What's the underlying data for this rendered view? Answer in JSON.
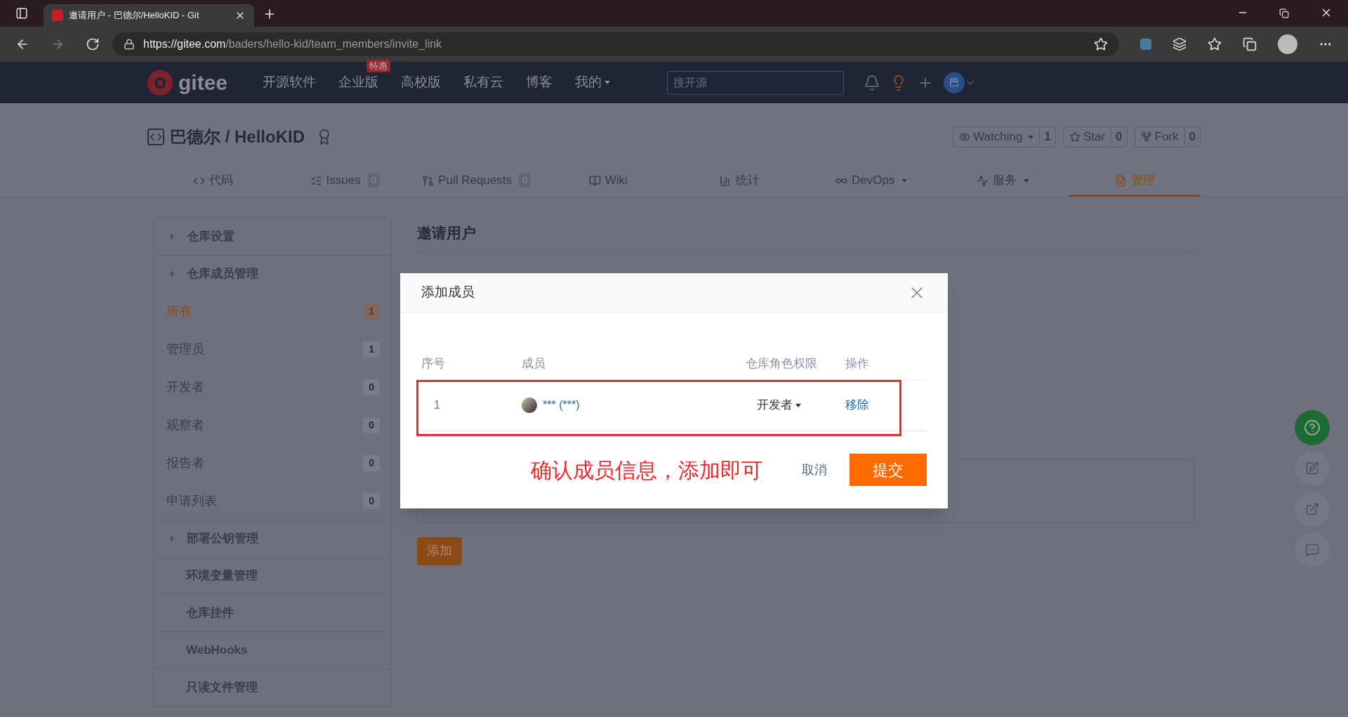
{
  "browser": {
    "tab_title": "邀请用户 - 巴德尔/HelloKID - Git",
    "url_host": "https://gitee.com",
    "url_path": "/baders/hello-kid/team_members/invite_link"
  },
  "nav": {
    "logo": "gitee",
    "items": [
      {
        "label": "开源软件",
        "caret": false
      },
      {
        "label": "企业版",
        "caret": false,
        "badge": "特惠"
      },
      {
        "label": "高校版",
        "caret": false
      },
      {
        "label": "私有云",
        "caret": false
      },
      {
        "label": "博客",
        "caret": false
      },
      {
        "label": "我的",
        "caret": true
      }
    ],
    "search": {
      "placeholder": "搜开源"
    },
    "avatar": "巴"
  },
  "repo": {
    "title": "巴德尔 / HelloKID",
    "actions": [
      {
        "label": "Watching",
        "caret": true,
        "count": "1"
      },
      {
        "label": "Star",
        "caret": false,
        "count": "0"
      },
      {
        "label": "Fork",
        "caret": false,
        "count": "0"
      }
    ],
    "tabs": [
      {
        "label": "代码",
        "selected": false,
        "caret": false
      },
      {
        "label": "Issues",
        "selected": false,
        "caret": false,
        "count": "0"
      },
      {
        "label": "Pull Requests",
        "selected": false,
        "caret": false,
        "count": "0"
      },
      {
        "label": "Wiki",
        "selected": false,
        "caret": false
      },
      {
        "label": "统计",
        "selected": false,
        "caret": false
      },
      {
        "label": "DevOps",
        "selected": false,
        "caret": true
      },
      {
        "label": "服务",
        "selected": false,
        "caret": true
      },
      {
        "label": "管理",
        "selected": true,
        "caret": false
      }
    ]
  },
  "sidebar": [
    {
      "label": "仓库设置",
      "kind": "group"
    },
    {
      "label": "仓库成员管理",
      "kind": "group",
      "children": [
        {
          "label": "所有",
          "count": "1",
          "selected": true
        },
        {
          "label": "管理员",
          "count": "1",
          "selected": false
        },
        {
          "label": "开发者",
          "count": "0",
          "selected": false
        },
        {
          "label": "观察者",
          "count": "0",
          "selected": false
        },
        {
          "label": "报告者",
          "count": "0",
          "selected": false
        },
        {
          "label": "申请列表",
          "count": "0",
          "selected": false
        }
      ]
    },
    {
      "label": "部署公钥管理",
      "kind": "group"
    },
    {
      "label": "环境变量管理",
      "kind": "link"
    },
    {
      "label": "仓库挂件",
      "kind": "link"
    },
    {
      "label": "WebHooks",
      "kind": "link"
    },
    {
      "label": "只读文件管理",
      "kind": "link"
    }
  ],
  "main": {
    "title": "邀请用户",
    "add_button": "添加"
  },
  "dialog": {
    "title": "添加成员",
    "columns": [
      "序号",
      "成员",
      "仓库角色权限",
      "操作"
    ],
    "rows": [
      {
        "index": "1",
        "member": "*** (***)",
        "role": "开发者",
        "action": "移除"
      }
    ],
    "annotation": "确认成员信息，添加即可",
    "cancel": "取消",
    "submit": "提交"
  }
}
